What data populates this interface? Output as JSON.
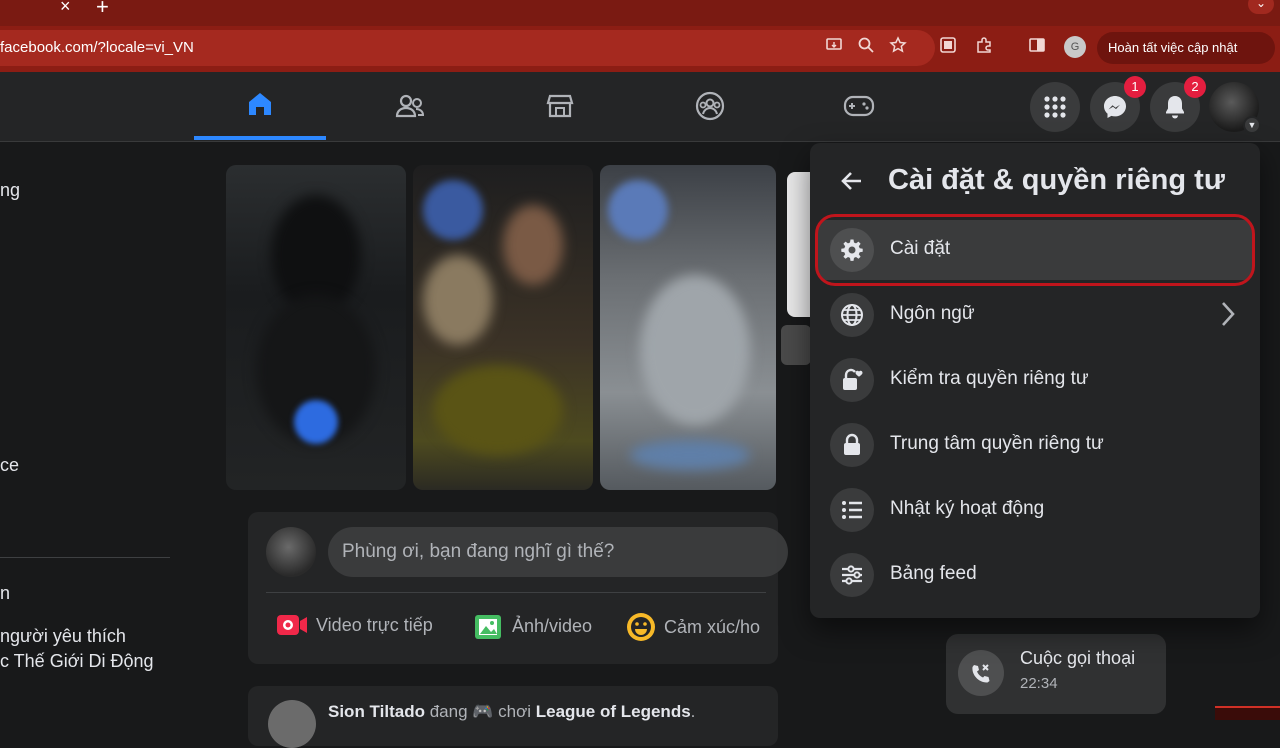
{
  "browser": {
    "tab_close": "×",
    "new_tab": "+",
    "url": "facebook.com/?locale=vi_VN",
    "profile_initial": "G",
    "complete_button": "Hoàn tất việc cập nhật",
    "window_control": "⌄"
  },
  "fb_nav": {
    "tabs": [
      "home",
      "friends",
      "marketplace",
      "groups",
      "gaming"
    ],
    "active_tab": "home",
    "messenger_badge": "1",
    "notifications_badge": "2",
    "accent": "#2d88ff",
    "badge_color": "#e41e3f"
  },
  "sidebar": {
    "fragment_1": "ng",
    "fragment_2": "ce",
    "fragment_3": "n",
    "fragment_4": "người yêu thích",
    "fragment_5": "c Thế Giới Di Động"
  },
  "composer": {
    "placeholder": "Phùng ơi, bạn đang nghĩ gì thế?",
    "live_video": "Video trực tiếp",
    "photo_video": "Ảnh/video",
    "feeling": "Cảm xúc/ho"
  },
  "post": {
    "author": "Sion Tiltado",
    "middle": "đang 🎮 chơi",
    "game": "League of Legends",
    "tail": "."
  },
  "call": {
    "title": "Cuộc gọi thoại",
    "time": "22:34"
  },
  "menu": {
    "title": "Cài đặt & quyền riêng tư",
    "items": [
      {
        "label": "Cài đặt",
        "icon": "gear-icon"
      },
      {
        "label": "Ngôn ngữ",
        "icon": "globe-icon"
      },
      {
        "label": "Kiểm tra quyền riêng tư",
        "icon": "lock-heart-icon"
      },
      {
        "label": "Trung tâm quyền riêng tư",
        "icon": "lock-icon"
      },
      {
        "label": "Nhật ký hoạt động",
        "icon": "list-icon"
      },
      {
        "label": "Bảng feed",
        "icon": "sliders-icon"
      }
    ],
    "highlight_color": "#c0151c"
  }
}
